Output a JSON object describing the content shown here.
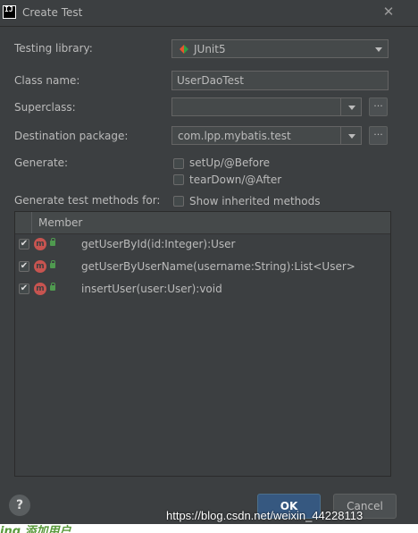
{
  "window": {
    "title": "Create Test",
    "app_icon": "intellij-icon",
    "close_icon": "close-icon"
  },
  "form": {
    "testing_library": {
      "label": "Testing library:",
      "value": "JUnit5",
      "icon": "junit-icon"
    },
    "class_name": {
      "label": "Class name:",
      "value": "UserDaoTest"
    },
    "superclass": {
      "label": "Superclass:",
      "value": "",
      "browse": "..."
    },
    "destination_package": {
      "label": "Destination package:",
      "value": "com.lpp.mybatis.test",
      "browse": "..."
    },
    "generate": {
      "label": "Generate:",
      "options": [
        {
          "label": "setUp/@Before",
          "checked": false
        },
        {
          "label": "tearDown/@After",
          "checked": false
        }
      ]
    },
    "generate_methods": {
      "label": "Generate test methods for:",
      "show_inherited": {
        "label": "Show inherited methods",
        "checked": false
      }
    }
  },
  "table": {
    "header": "Member",
    "rows": [
      {
        "checked": true,
        "signature": "getUserById(id:Integer):User"
      },
      {
        "checked": true,
        "signature": "getUserByUserName(username:String):List<User>"
      },
      {
        "checked": true,
        "signature": "insertUser(user:User):void"
      }
    ]
  },
  "buttons": {
    "help": "?",
    "ok": "OK",
    "cancel": "Cancel"
  },
  "watermark": "https://blog.csdn.net/weixin_44228113",
  "underlay_text": "ing  添加用户",
  "colors": {
    "background": "#3c3f41",
    "input": "#45494a",
    "accent": "#365880",
    "method_icon": "#c75450"
  }
}
